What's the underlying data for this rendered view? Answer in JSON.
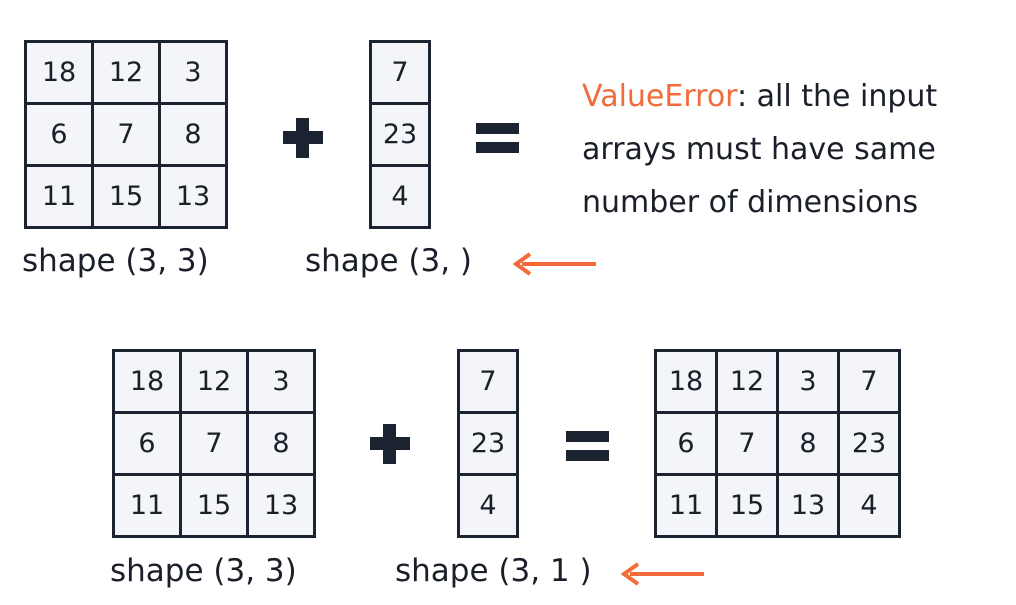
{
  "top": {
    "matrix_a": [
      [
        "18",
        "12",
        "3"
      ],
      [
        "6",
        "7",
        "8"
      ],
      [
        "11",
        "15",
        "13"
      ]
    ],
    "vector_b": [
      "7",
      "23",
      "4"
    ],
    "label_a": "shape (3, 3)",
    "label_b": "shape (3, )",
    "error": {
      "name": "ValueError",
      "message_lines": [
        ": all the input",
        "arrays must have same",
        "number of dimensions"
      ]
    }
  },
  "bottom": {
    "matrix_a": [
      [
        "18",
        "12",
        "3"
      ],
      [
        "6",
        "7",
        "8"
      ],
      [
        "11",
        "15",
        "13"
      ]
    ],
    "vector_b": [
      "7",
      "23",
      "4"
    ],
    "result": [
      [
        "18",
        "12",
        "3",
        "7"
      ],
      [
        "6",
        "7",
        "8",
        "23"
      ],
      [
        "11",
        "15",
        "13",
        "4"
      ]
    ],
    "label_a": "shape (3, 3)",
    "label_b": "shape (3, 1 )"
  },
  "colors": {
    "accent": "#f26b3a",
    "ink": "#1b2330",
    "cell_bg": "#f4f5f9"
  },
  "icons": [
    "plus-icon",
    "equals-icon",
    "arrow-left-icon"
  ]
}
